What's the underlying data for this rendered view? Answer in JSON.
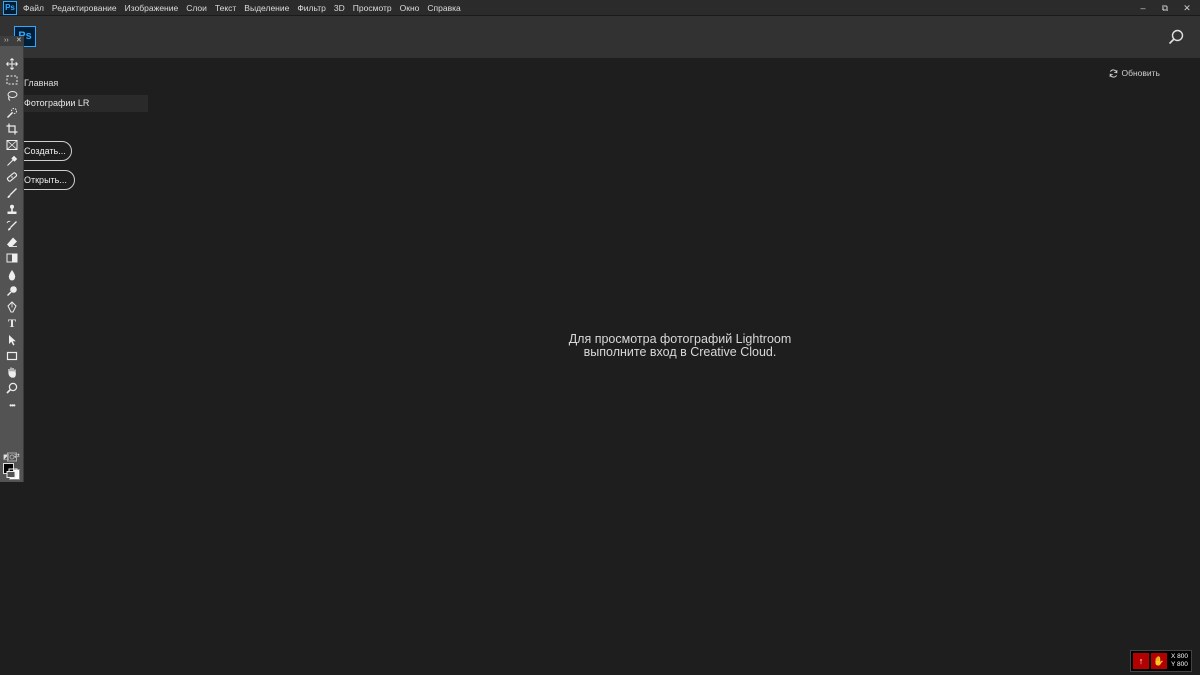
{
  "menubar": {
    "app_icon": "Ps",
    "items": [
      "Файл",
      "Редактирование",
      "Изображение",
      "Слои",
      "Текст",
      "Выделение",
      "Фильтр",
      "3D",
      "Просмотр",
      "Окно",
      "Справка"
    ],
    "window_controls": [
      "–",
      "⧉",
      "✕"
    ]
  },
  "header": {
    "logo": "Ps",
    "search_icon": "search-icon"
  },
  "nav": {
    "home": "Главная",
    "lr_photos": "Фотографии LR"
  },
  "actions": {
    "create": "Создать...",
    "open": "Открыть..."
  },
  "refresh": {
    "icon": "refresh-icon",
    "label": "Обновить"
  },
  "message": {
    "line1": "Для просмотра фотографий Lightroom",
    "line2": "выполните вход в Creative Cloud."
  },
  "toolbar": {
    "collapse": "››",
    "close": "✕",
    "tools": [
      "move-tool-icon",
      "marquee-tool-icon",
      "lasso-tool-icon",
      "quick-selection-tool-icon",
      "crop-tool-icon",
      "frame-tool-icon",
      "eyedropper-tool-icon",
      "healing-brush-tool-icon",
      "brush-tool-icon",
      "clone-stamp-tool-icon",
      "history-brush-tool-icon",
      "eraser-tool-icon",
      "gradient-tool-icon",
      "blur-tool-icon",
      "dodge-tool-icon",
      "pen-tool-icon",
      "type-tool-icon",
      "path-selection-tool-icon",
      "rectangle-tool-icon",
      "hand-tool-icon",
      "zoom-tool-icon",
      "more-tools-icon"
    ],
    "more_label": "•••",
    "type_label": "T",
    "fg_color": "#000000",
    "bg_color": "#ffffff"
  },
  "status_widget": {
    "x": "X 800",
    "y": "Y 800"
  },
  "colors": {
    "accent": "#31a8ff",
    "background": "#1e1e1e"
  }
}
